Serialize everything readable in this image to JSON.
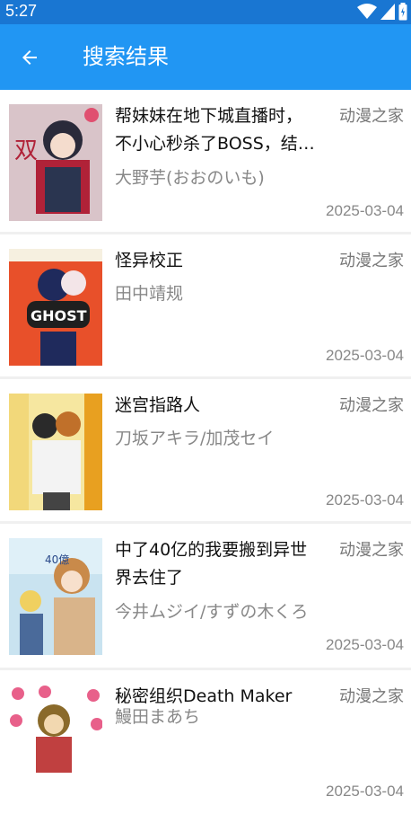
{
  "status": {
    "time": "5:27"
  },
  "appbar": {
    "title": "搜索结果"
  },
  "results": [
    {
      "name_line1": "帮妹妹在地下城直播时，",
      "name_line2": "不小心秒杀了BOSS，结…",
      "author": "大野芋(おおのいも)",
      "source": "动漫之家",
      "date": "2025-03-04",
      "cover_bg": "#d9c4c9",
      "cover_accent": "#b02238"
    },
    {
      "name_line1": "怪异校正",
      "name_line2": "",
      "author": "田中靖规",
      "source": "动漫之家",
      "date": "2025-03-04",
      "cover_bg": "#e8502a",
      "cover_accent": "#1f2a5c"
    },
    {
      "name_line1": "迷宫指路人",
      "name_line2": "",
      "author": "刀坂アキラ/加茂セイ",
      "source": "动漫之家",
      "date": "2025-03-04",
      "cover_bg": "#f6e7a0",
      "cover_accent": "#e8a020"
    },
    {
      "name_line1": "中了40亿的我要搬到异世",
      "name_line2": "界去住了",
      "author": "今井ムジイ/すずの木くろ",
      "source": "动漫之家",
      "date": "2025-03-04",
      "cover_bg": "#c9e3f0",
      "cover_accent": "#c98a4a"
    },
    {
      "name_line1": "秘密组织Death Maker",
      "name_line2": "",
      "author": "鰻田まあち",
      "source": "动漫之家",
      "date": "2025-03-04",
      "cover_bg": "#ffffff",
      "cover_accent": "#e8608a"
    }
  ]
}
